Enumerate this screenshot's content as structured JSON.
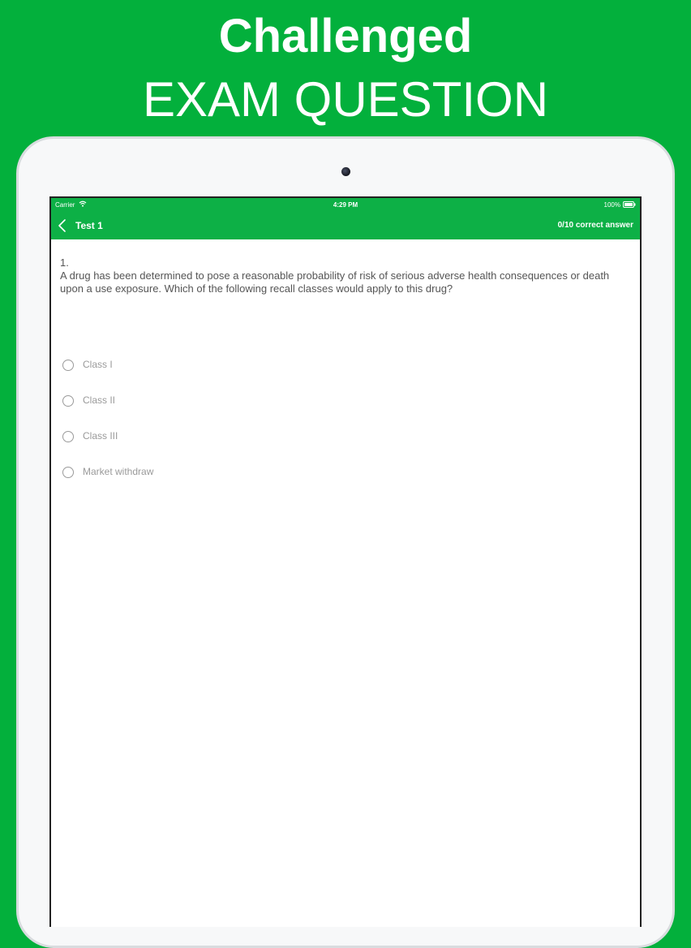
{
  "promo": {
    "line1": "Challenged",
    "line2": "EXAM QUESTION"
  },
  "status_bar": {
    "carrier": "Carrier",
    "time": "4:29 PM",
    "battery": "100%"
  },
  "nav": {
    "title": "Test 1",
    "score": "0/10 correct answer"
  },
  "question": {
    "number": "1.",
    "text": "A drug has been determined to pose a reasonable probability of risk of serious adverse health consequences or death upon a use exposure. Which of the following recall classes would apply to this drug?"
  },
  "options": [
    {
      "label": "Class I",
      "selected": false
    },
    {
      "label": "Class II",
      "selected": false
    },
    {
      "label": "Class III",
      "selected": false
    },
    {
      "label": "Market withdraw",
      "selected": false
    }
  ],
  "colors": {
    "background": "#03b03c",
    "bar": "#0db046",
    "option_text": "#9a9a9a"
  },
  "icons": {
    "back": "chevron-left-icon",
    "wifi": "wifi-icon",
    "battery": "battery-icon",
    "camera": "camera-icon"
  }
}
